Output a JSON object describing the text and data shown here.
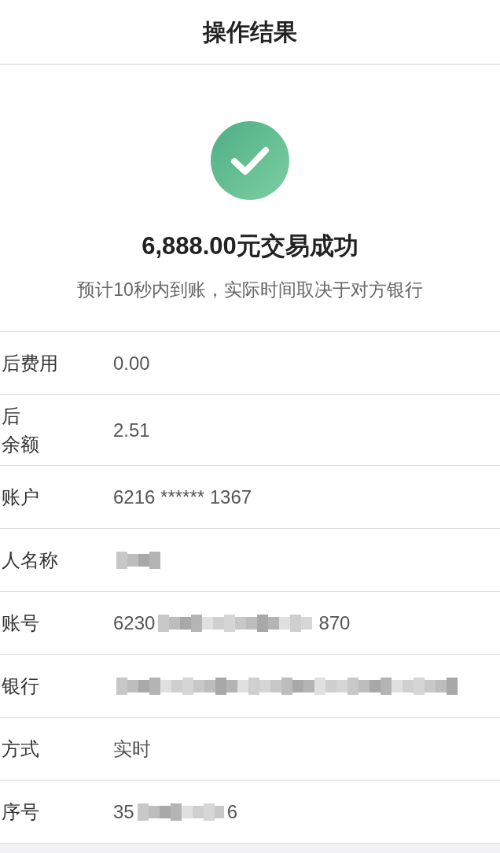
{
  "nav_bar": {
    "title": "操作结果"
  },
  "result": {
    "headline": "6,888.00元交易成功",
    "note": "预计10秒内到账，实际时间取决于对方银行"
  },
  "details": [
    {
      "label": [
        "后费用"
      ],
      "value": [
        {
          "kind": "text",
          "text": "0.00"
        }
      ]
    },
    {
      "label": [
        "后",
        "余额"
      ],
      "value": [
        {
          "kind": "text",
          "text": "2.51"
        }
      ]
    },
    {
      "label": [
        "账户"
      ],
      "value": [
        {
          "kind": "text",
          "text": "6216 ****** 1367"
        }
      ]
    },
    {
      "label": [
        "人名称"
      ],
      "value": [
        {
          "kind": "redacted"
        }
      ]
    },
    {
      "label": [
        "账号"
      ],
      "value": [
        {
          "kind": "text",
          "text": "6230"
        },
        {
          "kind": "redacted"
        },
        {
          "kind": "text",
          "text": "870"
        }
      ]
    },
    {
      "label": [
        "银行"
      ],
      "value": [
        {
          "kind": "redacted"
        }
      ]
    },
    {
      "label": [
        "方式"
      ],
      "value": [
        {
          "kind": "text",
          "text": "实时"
        }
      ]
    },
    {
      "label": [
        "序号"
      ],
      "value": [
        {
          "kind": "text",
          "text": "35"
        },
        {
          "kind": "redacted"
        },
        {
          "kind": "text",
          "text": "6"
        }
      ]
    }
  ]
}
